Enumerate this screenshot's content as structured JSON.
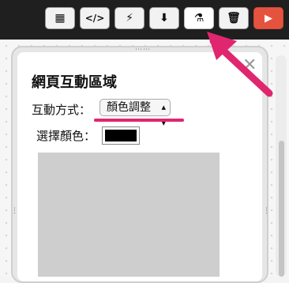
{
  "toolbar": {
    "buttons": [
      {
        "name": "qr-code-button",
        "icon": "qr-code-icon",
        "glyph": "▦"
      },
      {
        "name": "code-view-button",
        "icon": "code-icon",
        "glyph": "</>"
      },
      {
        "name": "flash-button",
        "icon": "lightning-icon",
        "glyph": "⚡"
      },
      {
        "name": "download-button",
        "icon": "download-box-icon",
        "glyph": "⬇"
      },
      {
        "name": "lab-button",
        "icon": "flask-icon",
        "glyph": "⚗"
      },
      {
        "name": "delete-button",
        "icon": "trash-icon",
        "glyph": "🗑"
      },
      {
        "name": "run-button",
        "icon": "play-icon",
        "glyph": "▶"
      }
    ]
  },
  "panel": {
    "title": "網頁互動區域",
    "mode_label": "互動方式：",
    "mode_value": "顏色調整",
    "color_label": "選擇顏色：",
    "selected_color": "#000000",
    "close_glyph": "✕"
  },
  "colors": {
    "highlight": "#e0266f",
    "run_button": "#e5533f",
    "preview_area": "#cecece"
  }
}
